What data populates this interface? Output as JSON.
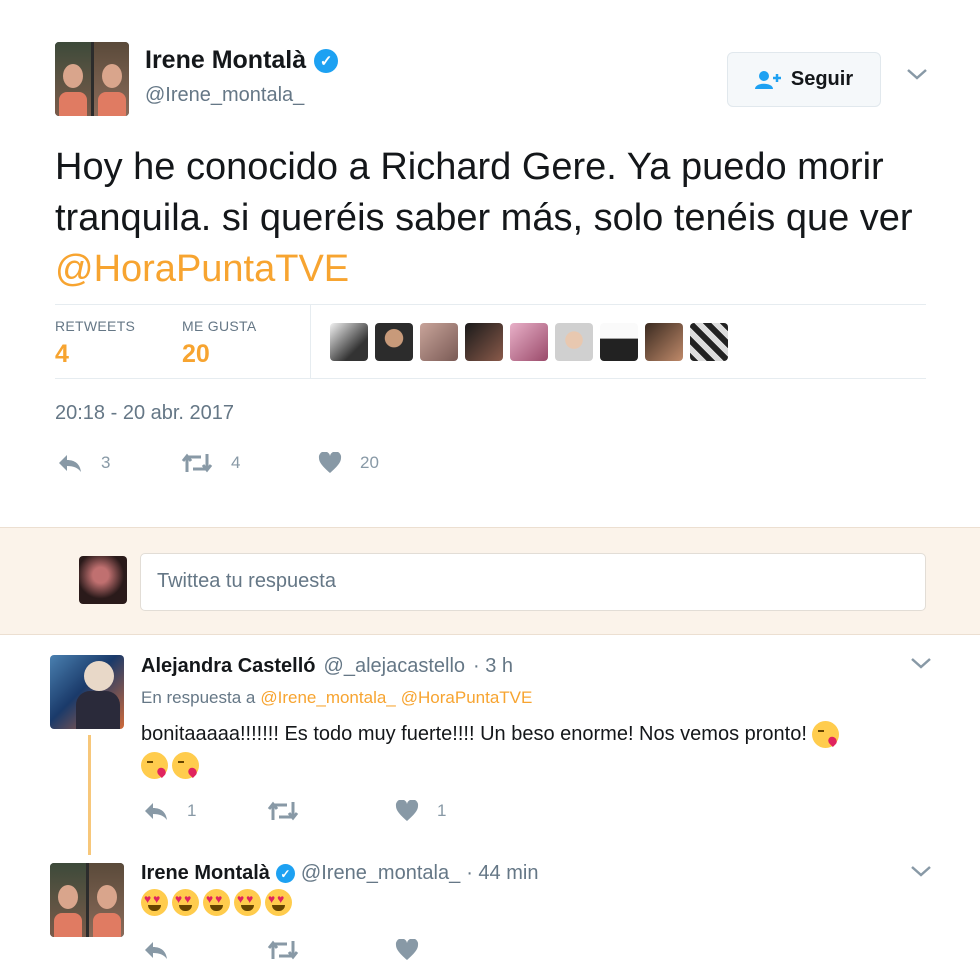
{
  "tweet": {
    "author_name": "Irene Montalà",
    "author_handle": "@Irene_montala_",
    "follow_label": "Seguir",
    "text_before": "Hoy he conocido a Richard Gere. Ya puedo morir tranquila. si queréis saber más, solo tenéis que ver ",
    "text_link": "@HoraPuntaTVE",
    "stats": {
      "retweets_label": "RETWEETS",
      "retweets_value": "4",
      "likes_label": "ME GUSTA",
      "likes_value": "20"
    },
    "timestamp": "20:18 - 20 abr. 2017",
    "actions": {
      "replies": "3",
      "retweets": "4",
      "likes": "20"
    }
  },
  "reply_box": {
    "placeholder": "Twittea tu respuesta"
  },
  "replies": [
    {
      "author_name": "Alejandra Castelló",
      "author_handle": "@_alejacastello",
      "time": "· 3 h",
      "in_reply_prefix": "En respuesta a",
      "in_reply_to_1": "@Irene_montala_",
      "in_reply_to_2": "@HoraPuntaTVE",
      "text": "bonitaaaaa!!!!!!! Es todo muy fuerte!!!! Un beso enorme! Nos vemos pronto!",
      "reply_count": "1",
      "like_count": "1"
    },
    {
      "author_name": "Irene Montalà",
      "author_handle": "@Irene_montala_",
      "time": "· 44 min"
    }
  ],
  "colors": {
    "link": "#f7a430",
    "verified": "#1da1f2",
    "reply_band": "#fbf3ea",
    "muted": "#657786"
  },
  "icons": [
    "verified-icon",
    "follow-user-icon",
    "chevron-down-icon",
    "reply-icon",
    "retweet-icon",
    "heart-icon"
  ]
}
